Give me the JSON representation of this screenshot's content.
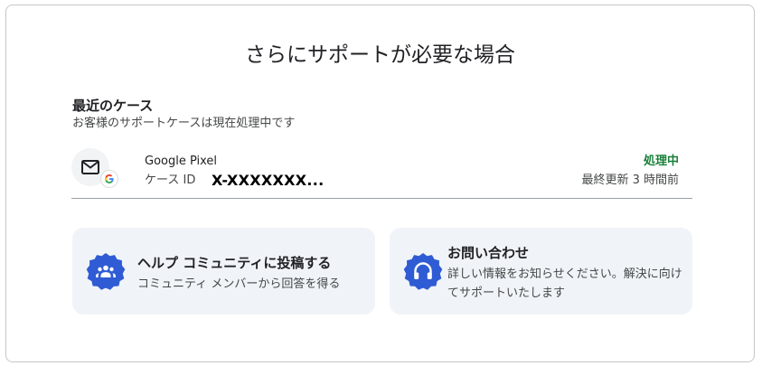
{
  "page": {
    "title": "さらにサポートが必要な場合"
  },
  "recent_cases": {
    "heading": "最近のケース",
    "subtitle": "お客様のサポートケースは現在処理中です",
    "case": {
      "avatar_icon": "mail-icon",
      "badge_icon": "google-g-icon",
      "product": "Google Pixel",
      "case_id_label": "ケース ID",
      "case_id_value": "X-XXXXXXX...",
      "status": "処理中",
      "status_color": "#188038",
      "updated": "最終更新 3 時間前"
    }
  },
  "options": [
    {
      "icon": "community-icon",
      "title": "ヘルプ コミュニティに投稿する",
      "description": "コミュニティ メンバーから回答を得る"
    },
    {
      "icon": "headset-icon",
      "title": "お問い合わせ",
      "description": "詳しい情報をお知らせください。解決に向けてサポートいたします"
    }
  ],
  "colors": {
    "accent_blue": "#2f5cd4",
    "card_background": "#f0f4f9"
  }
}
